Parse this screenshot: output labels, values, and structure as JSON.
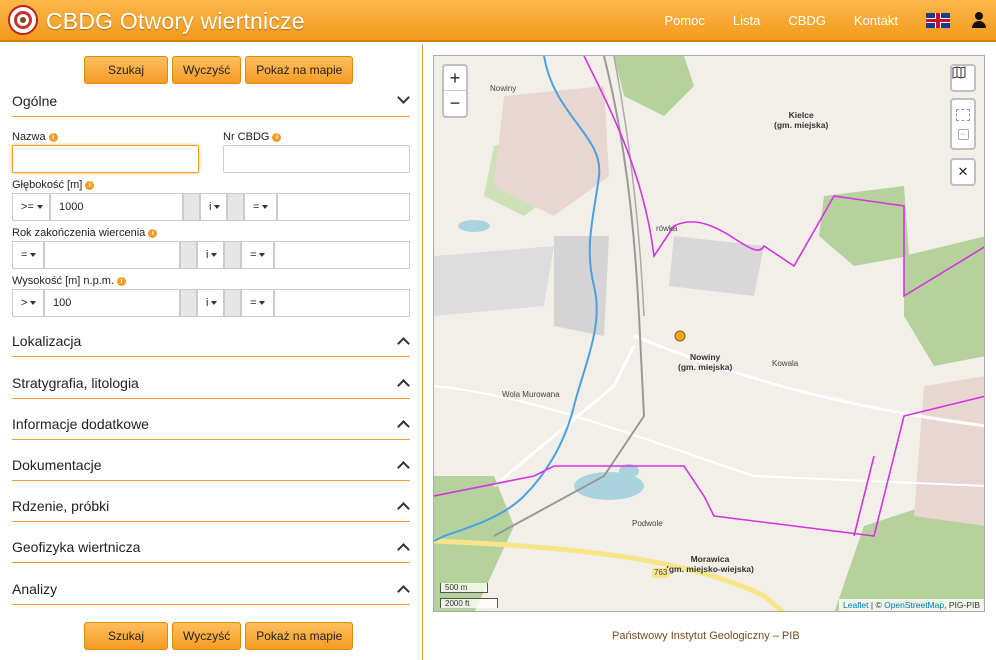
{
  "header": {
    "title": "CBDG Otwory wiertnicze",
    "nav": [
      "Pomoc",
      "Lista",
      "CBDG",
      "Kontakt"
    ]
  },
  "buttons": {
    "search": "Szukaj",
    "clear": "Wyczyść",
    "show_on_map": "Pokaż na mapie"
  },
  "sections": {
    "general": "Ogólne",
    "collapsed": [
      "Lokalizacja",
      "Stratygrafia, litologia",
      "Informacje dodatkowe",
      "Dokumentacje",
      "Rdzenie, próbki",
      "Geofizyka wiertnicza",
      "Analizy"
    ]
  },
  "form": {
    "name_label": "Nazwa",
    "name_value": "",
    "cbdg_label": "Nr CBDG",
    "cbdg_value": "",
    "depth": {
      "label": "Głębokość [m]",
      "op": ">=",
      "value": "1000",
      "logic": "i",
      "op2": "=",
      "value2": ""
    },
    "year": {
      "label": "Rok zakończenia wiercenia",
      "op": "=",
      "value": "",
      "logic": "i",
      "op2": "=",
      "value2": ""
    },
    "height": {
      "label": "Wysokość [m] n.p.m.",
      "op": ">",
      "value": "100",
      "logic": "i",
      "op2": "=",
      "value2": ""
    }
  },
  "map": {
    "labels": {
      "nowiny_top": "Nowiny",
      "kielce": "Kielce",
      "kielce_sub": "(gm. miejska)",
      "nowiny": "Nowiny",
      "nowiny_sub": "(gm. miejska)",
      "kowala": "Kowala",
      "wola": "Wola Murowana",
      "podwole": "Podwole",
      "morawica": "Morawica",
      "morawica_sub": "(gm. miejsko-wiejska)",
      "road": "763",
      "road2": "rówka"
    },
    "zoom_in": "+",
    "zoom_out": "−",
    "scale_m": "500 m",
    "scale_ft": "2000 ft",
    "attribution_leaflet": "Leaflet",
    "attribution_sep": " | © ",
    "attribution_osm": "OpenStreetMap",
    "attribution_rest": ", PIG-PIB",
    "colors": {
      "boundary": "#d633e0",
      "river": "#4aa0e0",
      "forest": "#b5d29d",
      "marker": "#f5a623"
    }
  },
  "footer": "Państwowy Instytut Geologiczny – PIB"
}
